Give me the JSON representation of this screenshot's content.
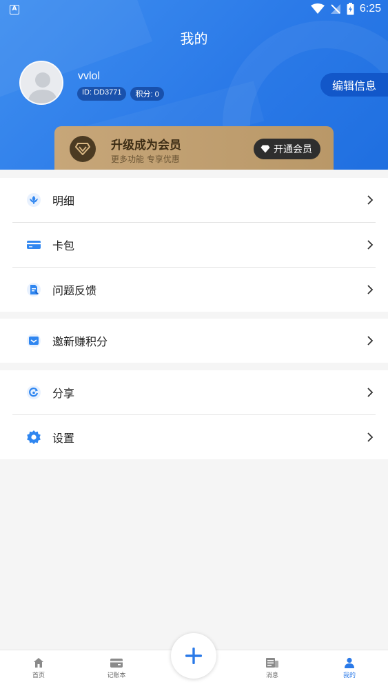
{
  "status": {
    "time": "6:25",
    "notif_letter": "A"
  },
  "page": {
    "title": "我的"
  },
  "profile": {
    "username": "vvlol",
    "id_label": "ID: DD3771",
    "points_label": "积分: 0",
    "edit_label": "编辑信息"
  },
  "vip": {
    "title": "升级成为会员",
    "subtitle": "更多功能   专享优惠",
    "button": "开通会员"
  },
  "menu": {
    "group1": [
      {
        "label": "明细",
        "icon": "flower-icon"
      },
      {
        "label": "卡包",
        "icon": "card-icon"
      },
      {
        "label": "问题反馈",
        "icon": "feedback-icon"
      }
    ],
    "group2": [
      {
        "label": "邀新赚积分",
        "icon": "invite-icon"
      }
    ],
    "group3": [
      {
        "label": "分享",
        "icon": "share-icon"
      },
      {
        "label": "设置",
        "icon": "gear-icon"
      }
    ]
  },
  "nav": {
    "items": [
      {
        "label": "首页",
        "icon": "home-icon"
      },
      {
        "label": "记账本",
        "icon": "ledger-icon"
      },
      {
        "label": "消息",
        "icon": "message-icon"
      },
      {
        "label": "我的",
        "icon": "user-icon"
      }
    ],
    "active": "我的",
    "fab": "add-icon"
  },
  "colors": {
    "primary": "#2b7ae8",
    "vip_gold": "#c7a679",
    "icon_blue": "#2f86f0"
  }
}
